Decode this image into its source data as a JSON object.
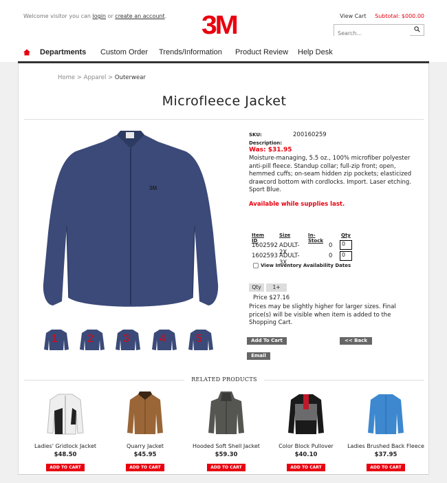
{
  "header": {
    "welcome_prefix": "Welcome visitor you can ",
    "login": "login",
    "or": " or ",
    "create_account": "create an account",
    "period": ".",
    "logo_text": "3M",
    "view_cart": "View Cart",
    "subtotal": "Subtotal: $000.00",
    "search_placeholder": "Search..."
  },
  "nav": {
    "items": [
      "Departments",
      "Custom Order",
      "Trends/Information",
      "Product Review",
      "Help Desk"
    ]
  },
  "breadcrumb": {
    "home": "Home",
    "apparel": "Apparel",
    "current": "Outerwear",
    "sep": " > "
  },
  "product": {
    "title": "Microfleece Jacket",
    "sku_label": "SKU:",
    "sku": "200160259",
    "description_label": "Description:",
    "was": "Was: $31.95",
    "description": "Moisture-managing, 5.5 oz., 100% microfiber polyester anti-pill fleece. Standup collar; full-zip front; open, hemmed cuffs; on-seam hidden zip pockets; elasticized drawcord bottom with cordlocks. Import. Laser etching. Sport Blue.",
    "availability": "Available while supplies last.",
    "thumb_numbers": [
      "1",
      "2",
      "3",
      "4",
      "5"
    ]
  },
  "inventory": {
    "headers": [
      "Item ID",
      "Size",
      "In-Stock",
      "Qty"
    ],
    "rows": [
      {
        "id": "1602592",
        "size": "ADULT-2X",
        "stock": "0",
        "qty": "0"
      },
      {
        "id": "1602593",
        "size": "ADULT-3X",
        "stock": "0",
        "qty": "0"
      }
    ],
    "view_dates": "View Inventory Availability Dates"
  },
  "pricing": {
    "qty_label": "Qty",
    "qty_value": "1+",
    "price": "Price $27.16",
    "note": "Prices may be slightly higher for larger sizes. Final price(s) will be visible when item is added to the Shopping Cart."
  },
  "buttons": {
    "add_to_cart": "Add To Cart",
    "back": "<< Back",
    "email": "Email"
  },
  "related": {
    "title": "RELATED PRODUCTS",
    "add_label": "ADD TO CART",
    "products": [
      {
        "name": "Ladies' Gridlock Jacket",
        "price": "$48.50"
      },
      {
        "name": "Quarry Jacket",
        "price": "$45.95"
      },
      {
        "name": "Hooded Soft Shell Jacket",
        "price": "$59.30"
      },
      {
        "name": "Color Block Pullover",
        "price": "$40.10"
      },
      {
        "name": "Ladies Brushed Back Fleece",
        "price": "$37.95"
      }
    ]
  },
  "colors": {
    "brand_red": "#e8000f",
    "jacket_blue": "#3b4a78"
  }
}
